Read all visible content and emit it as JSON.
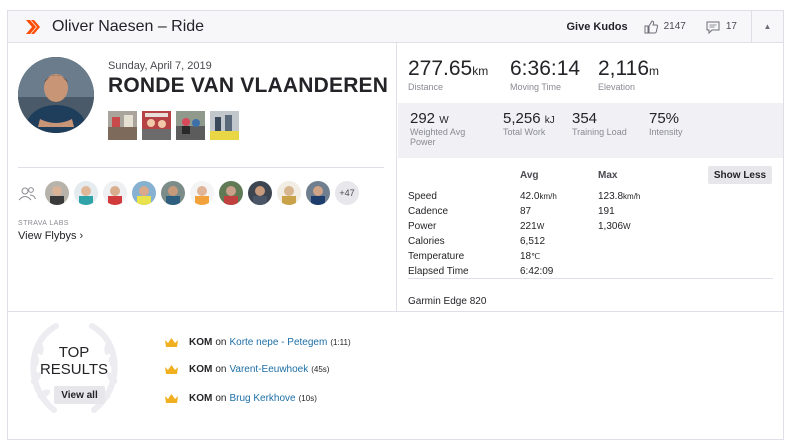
{
  "header": {
    "title": "Oliver Naesen – Ride",
    "kudos_label": "Give Kudos",
    "kudos_count": "2147",
    "comment_count": "17",
    "brand_color": "#fc4c02"
  },
  "summary": {
    "date": "Sunday, April 7, 2019",
    "ride_name": "RONDE VAN VLAANDEREN",
    "labs_label": "STRAVA LABS",
    "flybys_label": "View Flybys ›",
    "more_athletes": "+47"
  },
  "primary_stats": [
    {
      "value": "277.65",
      "unit": "km",
      "label": "Distance"
    },
    {
      "value": "6:36:14",
      "unit": "",
      "label": "Moving Time"
    },
    {
      "value": "2,116",
      "unit": "m",
      "label": "Elevation"
    }
  ],
  "secondary_stats": [
    {
      "value": "292",
      "unit": "W",
      "label": "Weighted Avg Power"
    },
    {
      "value": "5,256",
      "unit": "kJ",
      "label": "Total Work"
    },
    {
      "value": "354",
      "unit": "",
      "label": "Training Load"
    },
    {
      "value": "75%",
      "unit": "",
      "label": "Intensity"
    }
  ],
  "more_stats": {
    "avg_header": "Avg",
    "max_header": "Max",
    "show_less_label": "Show Less",
    "rows": [
      {
        "label": "Speed",
        "avg": "42.0",
        "avg_unit": "km/h",
        "max": "123.8",
        "max_unit": "km/h"
      },
      {
        "label": "Cadence",
        "avg": "87",
        "avg_unit": "",
        "max": "191",
        "max_unit": ""
      },
      {
        "label": "Power",
        "avg": "221",
        "avg_unit": "W",
        "max": "1,306",
        "max_unit": "W"
      },
      {
        "label": "Calories",
        "avg": "6,512",
        "avg_unit": "",
        "max": "",
        "max_unit": ""
      },
      {
        "label": "Temperature",
        "avg": "18",
        "avg_unit": "℃",
        "max": "",
        "max_unit": ""
      },
      {
        "label": "Elapsed Time",
        "avg": "6:42:09",
        "avg_unit": "",
        "max": "",
        "max_unit": ""
      }
    ],
    "device": "Garmin Edge 820"
  },
  "results": {
    "title_line1": "TOP",
    "title_line2": "RESULTS",
    "view_all_label": "View all",
    "koms": [
      {
        "label": "KOM",
        "on": "on",
        "segment": "Korte nepe - Petegem",
        "time": "(1:11)"
      },
      {
        "label": "KOM",
        "on": "on",
        "segment": "Varent-Eeuwhoek",
        "time": "(45s)"
      },
      {
        "label": "KOM",
        "on": "on",
        "segment": "Brug Kerkhove",
        "time": "(10s)"
      }
    ]
  }
}
